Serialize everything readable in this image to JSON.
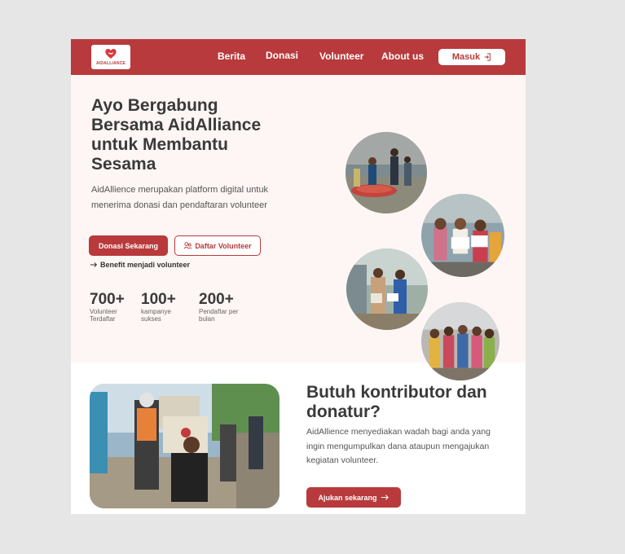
{
  "nav": {
    "logo_text": "AIDALLIANCE",
    "links": [
      "Berita",
      "Donasi",
      "Volunteer",
      "About us"
    ],
    "login_label": "Masuk"
  },
  "hero": {
    "title": "Ayo Bergabung Bersama AidAlliance untuk Membantu Sesama",
    "description": "AidAllience merupakan platform digital untuk menerima donasi dan pendaftaran volunteer",
    "donate_button": "Donasi Sekarang",
    "volunteer_button": "Daftar Volunteer",
    "benefit_link": "Benefit menjadi volunteer",
    "stats": [
      {
        "value": "700+",
        "label": "Volunteer Terdaftar"
      },
      {
        "value": "100+",
        "label": "kampanye sukses"
      },
      {
        "value": "200+",
        "label": "Pendaftar per bulan"
      }
    ]
  },
  "contributor": {
    "title": "Butuh kontributor dan donatur?",
    "description": "AidAllience menyediakan wadah bagi anda  yang ingin mengumpulkan dana ataupun mengajukan kegiatan volunteer.",
    "apply_button": "Ajukan sekarang"
  },
  "colors": {
    "brand_red": "#b83a3c",
    "hero_bg": "#fdf6f4",
    "page_bg": "#e6e6e6"
  },
  "icons": [
    "heart-logo-icon",
    "login-icon",
    "users-icon",
    "arrow-right-icon"
  ]
}
